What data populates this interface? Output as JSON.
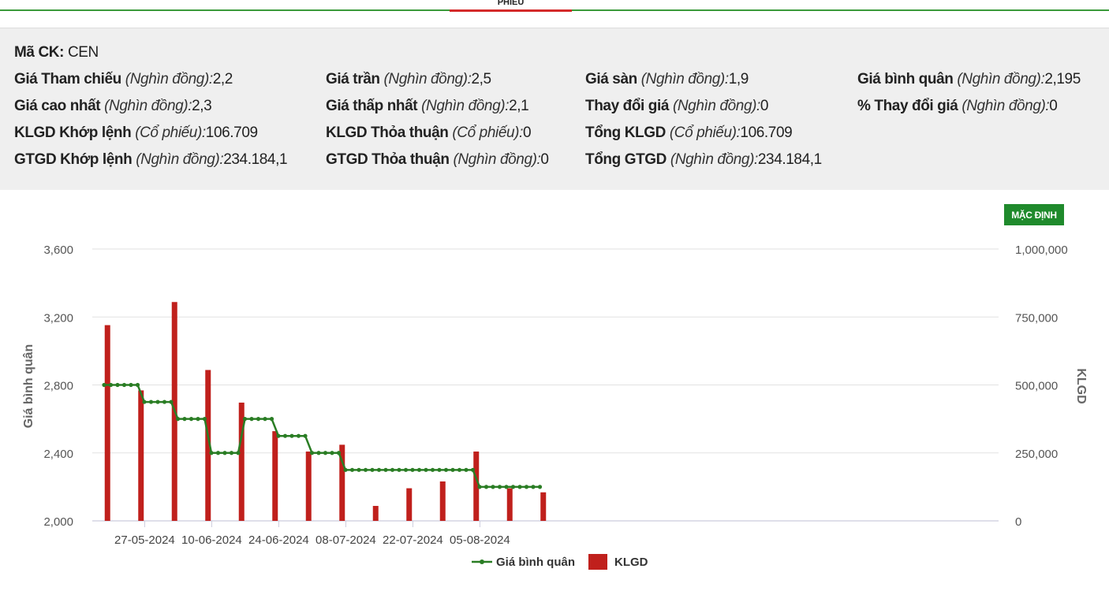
{
  "top_tab": "PHIẾU",
  "info": {
    "ticker": {
      "label": "Mã CK:",
      "value": "CEN"
    },
    "rows": [
      [
        {
          "label": "Giá Tham chiếu",
          "unit": "(Nghìn đồng):",
          "value": "2,2"
        },
        {
          "label": "Giá trần",
          "unit": "(Nghìn đồng):",
          "value": "2,5"
        },
        {
          "label": "Giá sàn",
          "unit": "(Nghìn đồng):",
          "value": "1,9"
        },
        {
          "label": "Giá bình quân",
          "unit": "(Nghìn đồng):",
          "value": "2,195"
        }
      ],
      [
        {
          "label": "Giá cao nhất",
          "unit": "(Nghìn đồng):",
          "value": "2,3"
        },
        {
          "label": "Giá thấp nhất",
          "unit": "(Nghìn đồng):",
          "value": "2,1"
        },
        {
          "label": "Thay đổi giá",
          "unit": "(Nghìn đồng):",
          "value": "0"
        },
        {
          "label": "% Thay đổi giá",
          "unit": "(Nghìn đồng):",
          "value": "0"
        }
      ],
      [
        {
          "label": "KLGD Khớp lệnh",
          "unit": "(Cổ phiếu):",
          "value": "106.709"
        },
        {
          "label": "KLGD Thỏa thuận",
          "unit": "(Cổ phiếu):",
          "value": "0"
        },
        {
          "label": "Tổng KLGD",
          "unit": "(Cổ phiếu):",
          "value": "106.709"
        }
      ],
      [
        {
          "label": "GTGD Khớp lệnh",
          "unit": "(Nghìn đồng):",
          "value": "234.184,1"
        },
        {
          "label": "GTGD Thỏa thuận",
          "unit": "(Nghìn đồng):",
          "value": "0"
        },
        {
          "label": "Tổng GTGD",
          "unit": "(Nghìn đồng):",
          "value": "234.184,1"
        }
      ]
    ]
  },
  "default_button": "MẶC ĐỊNH",
  "chart_data": {
    "type": "bar+line",
    "ylabel_left": "Giá bình quân",
    "ylabel_right": "KLGD",
    "ylim_left": [
      2000,
      3600
    ],
    "ylim_right": [
      0,
      1000000
    ],
    "yticks_left": [
      "2,000",
      "2,400",
      "2,800",
      "3,200",
      "3,600"
    ],
    "yticks_right": [
      "0",
      "250,000",
      "500,000",
      "750,000",
      "1,000,000"
    ],
    "x_tick_labels": [
      "27-05-2024",
      "10-06-2024",
      "24-06-2024",
      "08-07-2024",
      "22-07-2024",
      "05-08-2024"
    ],
    "x_tick_index": [
      6,
      16,
      26,
      36,
      46,
      56
    ],
    "grid": true,
    "legend_position": "bottom-center",
    "series": [
      {
        "name": "Giá bình quân",
        "type": "line",
        "color": "#2a7d24",
        "values": [
          2800,
          2800,
          2800,
          2800,
          2800,
          2800,
          2700,
          2700,
          2700,
          2700,
          2700,
          2600,
          2600,
          2600,
          2600,
          2600,
          2400,
          2400,
          2400,
          2400,
          2400,
          2600,
          2600,
          2600,
          2600,
          2600,
          2500,
          2500,
          2500,
          2500,
          2500,
          2400,
          2400,
          2400,
          2400,
          2400,
          2300,
          2300,
          2300,
          2300,
          2300,
          2300,
          2300,
          2300,
          2300,
          2300,
          2300,
          2300,
          2300,
          2300,
          2300,
          2300,
          2300,
          2300,
          2300,
          2300,
          2200,
          2200,
          2200,
          2200,
          2200,
          2200,
          2200,
          2200,
          2200,
          2200
        ]
      },
      {
        "name": "KLGD",
        "type": "bar",
        "color": "#c0201c",
        "bars": [
          [
            1,
            720000
          ],
          [
            11,
            480000
          ],
          [
            21,
            805000
          ],
          [
            31,
            555000
          ],
          [
            41,
            435000
          ],
          [
            51,
            330000
          ],
          [
            61,
            255000
          ],
          [
            71,
            280000
          ],
          [
            81,
            55000
          ],
          [
            91,
            120000
          ],
          [
            101,
            145000
          ],
          [
            111,
            255000
          ],
          [
            121,
            120000
          ],
          [
            131,
            105000
          ]
        ]
      }
    ]
  }
}
